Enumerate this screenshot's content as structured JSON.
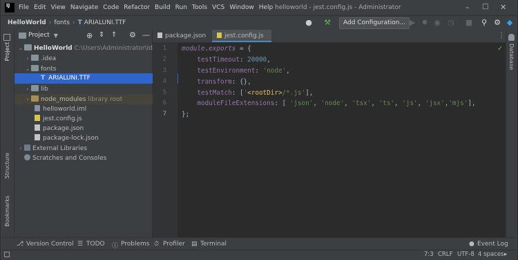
{
  "menubar": {
    "logo": "IJ",
    "items": [
      "File",
      "Edit",
      "View",
      "Navigate",
      "Code",
      "Refactor",
      "Build",
      "Run",
      "Tools",
      "VCS",
      "Window",
      "Help"
    ],
    "title": "helloworld - jest.config.js - Administrator"
  },
  "navbar": {
    "breadcrumbs": [
      "HelloWorld",
      "fonts",
      "ARIALUNI.TTF"
    ],
    "add_config_label": "Add Configuration..."
  },
  "project_panel": {
    "title": "Project",
    "tree": [
      {
        "label": "HelloWorld",
        "hint": "C:\\Users\\Administrator\\IdeaPro",
        "icon": "folder-icon"
      },
      {
        "label": ".idea",
        "hint": "",
        "icon": "folder-icon"
      },
      {
        "label": "fonts",
        "hint": "",
        "icon": "folder-icon"
      },
      {
        "label": "ARIALUNI.TTF",
        "hint": "",
        "icon": "font-file-icon"
      },
      {
        "label": "lib",
        "hint": "",
        "icon": "folder-icon"
      },
      {
        "label": "node_modules",
        "hint": "library root",
        "icon": "folder-icon"
      },
      {
        "label": "helloworld.iml",
        "hint": "",
        "icon": "iml-file-icon"
      },
      {
        "label": "jest.config.js",
        "hint": "",
        "icon": "js-file-icon"
      },
      {
        "label": "package.json",
        "hint": "",
        "icon": "json-file-icon"
      },
      {
        "label": "package-lock.json",
        "hint": "",
        "icon": "json-file-icon"
      },
      {
        "label": "External Libraries",
        "hint": "",
        "icon": "library-icon"
      },
      {
        "label": "Scratches and Consoles",
        "hint": "",
        "icon": "scratches-icon"
      }
    ]
  },
  "editor": {
    "tabs": [
      "package.json",
      "jest.config.js"
    ],
    "active_tab": 1,
    "line_numbers": [
      "1",
      "2",
      "3",
      "4",
      "5",
      "6",
      "7"
    ]
  },
  "left_strip": {
    "project": "Project",
    "structure": "Structure",
    "bookmarks": "Bookmarks"
  },
  "right_strip": {
    "database": "Database"
  },
  "bottom_tools": [
    "Version Control",
    "TODO",
    "Problems",
    "Profiler",
    "Terminal"
  ],
  "event_log": "Event Log",
  "status": {
    "position": "7:3",
    "line_sep": "CRLF",
    "encoding": "UTF-8",
    "indent": "4 spaces"
  },
  "colors": {
    "accent": "#2f65ca",
    "bg": "#2b2b2b",
    "panel": "#3c3f41"
  }
}
